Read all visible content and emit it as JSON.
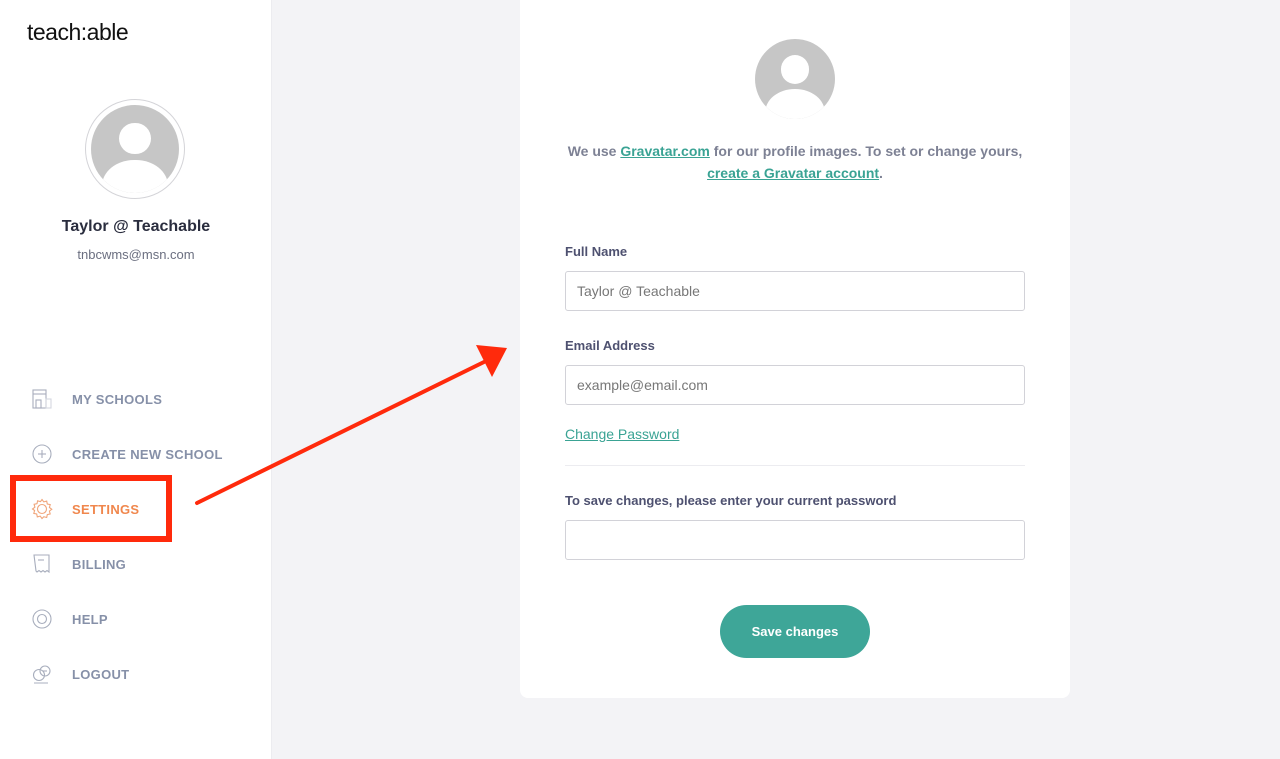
{
  "brand": {
    "logo_text": "teach:able"
  },
  "sidebar": {
    "user_name": "Taylor @ Teachable",
    "user_email": "tnbcwms@msn.com",
    "items": [
      {
        "label": "MY SCHOOLS",
        "icon": "school-building-icon",
        "active": false
      },
      {
        "label": "CREATE NEW SCHOOL",
        "icon": "plus-circle-icon",
        "active": false
      },
      {
        "label": "SETTINGS",
        "icon": "gear-icon",
        "active": true
      },
      {
        "label": "BILLING",
        "icon": "receipt-icon",
        "active": false
      },
      {
        "label": "HELP",
        "icon": "lifebuoy-icon",
        "active": false
      },
      {
        "label": "LOGOUT",
        "icon": "logout-icon",
        "active": false
      }
    ]
  },
  "annotation": {
    "highlight_color": "#ff2a0c",
    "arrow_color": "#ff2a0c"
  },
  "profile_form": {
    "gravatar_text_1": "We use ",
    "gravatar_link": "Gravatar.com",
    "gravatar_text_2": " for our profile images. To set or change yours, ",
    "gravatar_account_link": "create a Gravatar account",
    "gravatar_text_3": ".",
    "full_name_label": "Full Name",
    "full_name_value": "",
    "full_name_placeholder": "Taylor @ Teachable",
    "email_label": "Email Address",
    "email_value": "",
    "email_placeholder": "example@email.com",
    "change_password_link": "Change Password",
    "current_password_label": "To save changes, please enter your current password",
    "current_password_value": "",
    "save_button": "Save changes"
  },
  "colors": {
    "accent": "#3ea698",
    "active_nav": "#f0874d",
    "nav_text": "#8690a8",
    "background": "#f3f3f6"
  }
}
